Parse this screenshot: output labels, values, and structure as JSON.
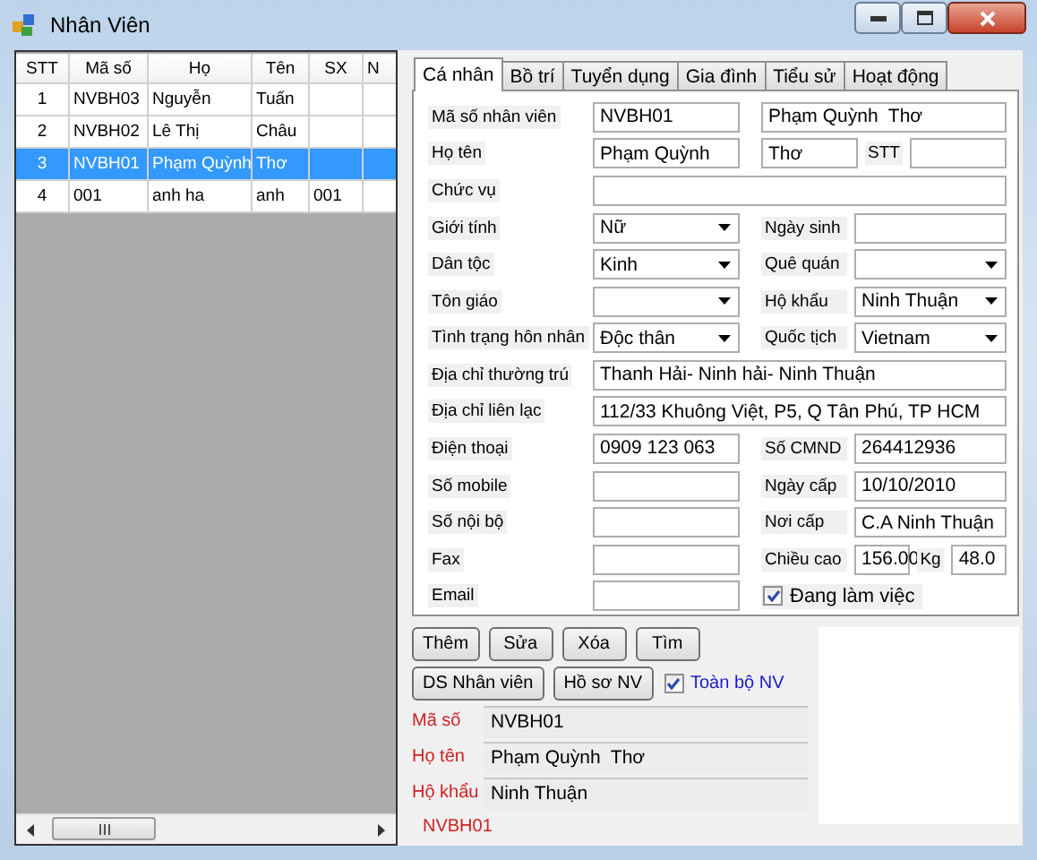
{
  "window": {
    "title": "Nhân Viên"
  },
  "grid": {
    "columns": [
      "STT",
      "Mã số",
      "Họ",
      "Tên",
      "SX",
      "N"
    ],
    "rows": [
      {
        "cells": [
          "1",
          "NVBH03",
          "Nguyễn",
          "Tuấn",
          "",
          ""
        ],
        "selected": false
      },
      {
        "cells": [
          "2",
          "NVBH02",
          "Lê Thị",
          "Châu",
          "",
          ""
        ],
        "selected": false
      },
      {
        "cells": [
          "3",
          "NVBH01",
          "Phạm Quỳnh",
          "Thơ",
          "",
          ""
        ],
        "selected": true
      },
      {
        "cells": [
          "4",
          "001",
          "anh ha",
          "anh",
          "001",
          ""
        ],
        "selected": false
      }
    ]
  },
  "tabs": [
    {
      "label": "Cá nhân",
      "selected": true
    },
    {
      "label": "Bồ trí",
      "selected": false
    },
    {
      "label": "Tuyển dụng",
      "selected": false
    },
    {
      "label": "Gia đình",
      "selected": false
    },
    {
      "label": "Tiểu sử",
      "selected": false
    },
    {
      "label": "Hoạt động",
      "selected": false
    }
  ],
  "form": [
    {
      "items": [
        {
          "kind": "label",
          "text": "Mã số nhân viên"
        },
        {
          "kind": "text",
          "value": "NVBH01"
        },
        {
          "kind": "text",
          "value": "Phạm Quỳnh  Thơ"
        }
      ]
    },
    {
      "items": [
        {
          "kind": "label",
          "text": "Họ tên"
        },
        {
          "kind": "text",
          "value": "Phạm Quỳnh"
        },
        {
          "kind": "text",
          "value": "Thơ"
        },
        {
          "kind": "label",
          "text": "STT"
        },
        {
          "kind": "text"
        }
      ]
    },
    {
      "items": [
        {
          "kind": "label",
          "text": "Chức vụ"
        },
        {
          "kind": "text"
        }
      ]
    },
    {
      "items": [
        {
          "kind": "label",
          "text": "Giới tính"
        },
        {
          "kind": "combo",
          "value": "Nữ"
        },
        {
          "kind": "label",
          "text": "Ngày sinh"
        },
        {
          "kind": "text"
        }
      ]
    },
    {
      "items": [
        {
          "kind": "label",
          "text": "Dân tộc"
        },
        {
          "kind": "combo",
          "value": "Kinh"
        },
        {
          "kind": "label",
          "text": "Quê quán"
        },
        {
          "kind": "combo"
        }
      ]
    },
    {
      "items": [
        {
          "kind": "label",
          "text": "Tôn giáo"
        },
        {
          "kind": "combo"
        },
        {
          "kind": "label",
          "text": "Hộ khẩu"
        },
        {
          "kind": "combo",
          "value": "Ninh Thuận"
        }
      ]
    },
    {
      "items": [
        {
          "kind": "label",
          "text": "Tình trạng hôn nhân"
        },
        {
          "kind": "combo",
          "value": "Độc thân"
        },
        {
          "kind": "label",
          "text": "Quốc tịch"
        },
        {
          "kind": "combo",
          "value": "Vietnam"
        }
      ]
    },
    {
      "items": [
        {
          "kind": "label",
          "text": "Địa chỉ thường trú"
        },
        {
          "kind": "text",
          "value": "Thanh Hải- Ninh hải- Ninh Thuận"
        }
      ]
    },
    {
      "items": [
        {
          "kind": "label",
          "text": "Địa chỉ liên lạc"
        },
        {
          "kind": "text",
          "value": "112/33 Khuông Việt, P5, Q Tân Phú, TP HCM"
        }
      ]
    },
    {
      "items": [
        {
          "kind": "label",
          "text": "Điện thoại"
        },
        {
          "kind": "text",
          "value": "0909 123 063"
        },
        {
          "kind": "label",
          "text": "Số CMND"
        },
        {
          "kind": "text",
          "value": "264412936"
        }
      ]
    },
    {
      "items": [
        {
          "kind": "label",
          "text": "Số mobile"
        },
        {
          "kind": "text"
        },
        {
          "kind": "label",
          "text": "Ngày cấp"
        },
        {
          "kind": "text",
          "value": "10/10/2010"
        }
      ]
    },
    {
      "items": [
        {
          "kind": "label",
          "text": "Số nội bộ"
        },
        {
          "kind": "text"
        },
        {
          "kind": "label",
          "text": "Nơi cấp"
        },
        {
          "kind": "text",
          "value": "C.A Ninh Thuận"
        }
      ]
    },
    {
      "items": [
        {
          "kind": "label",
          "text": "Fax"
        },
        {
          "kind": "text"
        },
        {
          "kind": "label",
          "text": "Chiều cao"
        },
        {
          "kind": "text",
          "value": "156.00"
        },
        {
          "kind": "label",
          "text": "Kg"
        },
        {
          "kind": "text",
          "value": "48.0"
        }
      ]
    },
    {
      "items": [
        {
          "kind": "label",
          "text": "Email"
        },
        {
          "kind": "text"
        },
        {
          "kind": "check",
          "text": "Đang làm việc",
          "checked": true
        }
      ]
    }
  ],
  "buttons": [
    "Thêm",
    "Sửa",
    "Xóa",
    "Tìm"
  ],
  "buttons_2": [
    "DS Nhân viên",
    "Hồ sơ NV"
  ],
  "all_staff": {
    "label": "Toàn bộ NV",
    "checked": true
  },
  "summary": [
    {
      "label": "Mã số",
      "value": "NVBH01"
    },
    {
      "label": "Họ tên",
      "value": "Phạm Quỳnh  Thơ"
    },
    {
      "label": "Hộ khẩu",
      "value": "Ninh Thuận"
    }
  ],
  "footer_code": "NVBH01"
}
